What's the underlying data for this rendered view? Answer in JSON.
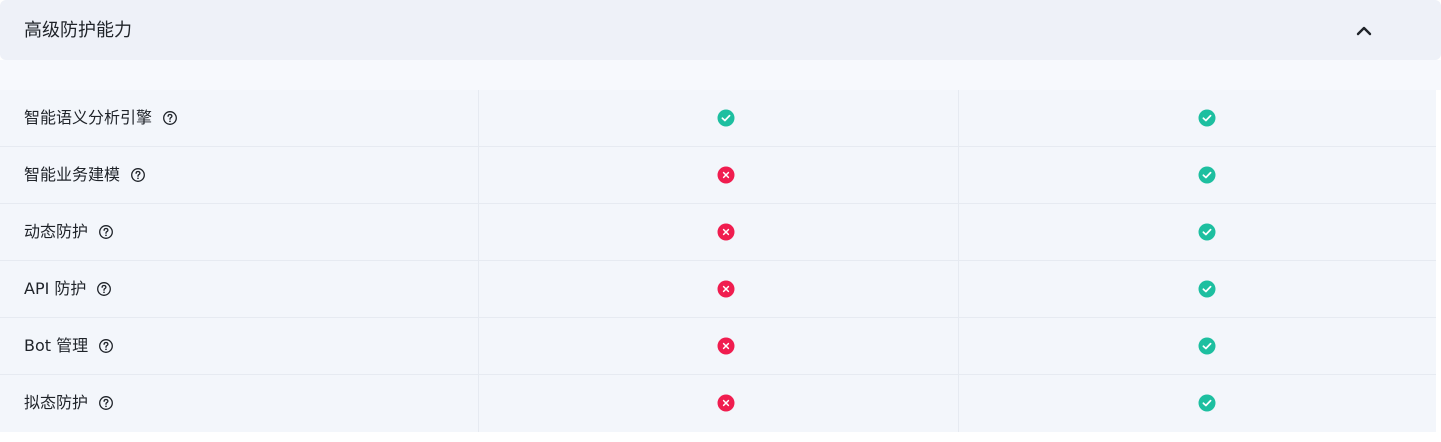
{
  "section": {
    "title": "高级防护能力",
    "collapse_icon": "chevron-up-icon"
  },
  "colors": {
    "supported": "#1dbfa0",
    "unsupported": "#f01d4f",
    "header_bg": "#eef1f8",
    "row_bg": "#f3f6fb"
  },
  "features": [
    {
      "label": "智能语义分析引擎",
      "col_a": "supported",
      "col_b": "supported"
    },
    {
      "label": "智能业务建模",
      "col_a": "unsupported",
      "col_b": "supported"
    },
    {
      "label": "动态防护",
      "col_a": "unsupported",
      "col_b": "supported"
    },
    {
      "label": "API 防护",
      "col_a": "unsupported",
      "col_b": "supported"
    },
    {
      "label": "Bot 管理",
      "col_a": "unsupported",
      "col_b": "supported"
    },
    {
      "label": "拟态防护",
      "col_a": "unsupported",
      "col_b": "supported"
    }
  ]
}
